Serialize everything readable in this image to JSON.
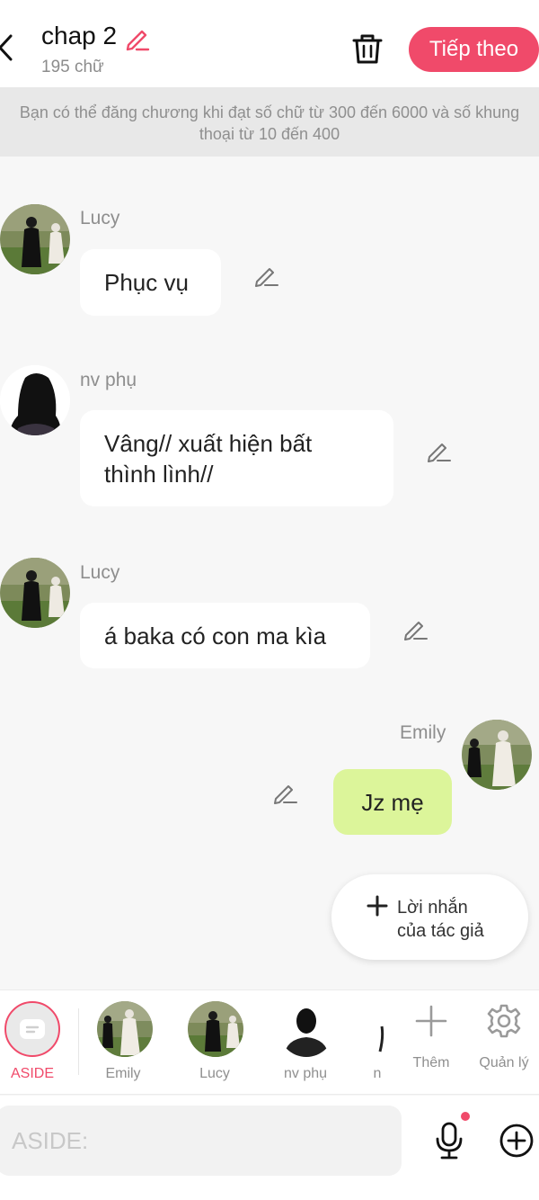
{
  "header": {
    "chapter_title": "chap 2",
    "word_count": "195 chữ",
    "next_label": "Tiếp theo"
  },
  "notice": "Bạn có thể đăng chương khi đạt số chữ từ 300 đến 6000 và số khung thoại từ 10 đến 400",
  "messages": [
    {
      "speaker": "Lucy",
      "text": "Phục vụ"
    },
    {
      "speaker": "nv phụ",
      "text": "Vâng// xuất hiện bất thình lình//"
    },
    {
      "speaker": "Lucy",
      "text": "á baka có con ma kìa"
    },
    {
      "speaker": "Emily",
      "text": "Jz mẹ"
    }
  ],
  "author_note": {
    "line1": "Lời nhắn",
    "line2": "của tác giả"
  },
  "characters": [
    {
      "label": "ASIDE"
    },
    {
      "label": "Emily"
    },
    {
      "label": "Lucy"
    },
    {
      "label": "nv phụ"
    },
    {
      "label": "n"
    }
  ],
  "tools": {
    "add_label": "Thêm",
    "manage_label": "Quản lý"
  },
  "input": {
    "placeholder": "ASIDE:"
  },
  "colors": {
    "accent": "#f04a6a",
    "right_bubble": "#dcf59a"
  }
}
